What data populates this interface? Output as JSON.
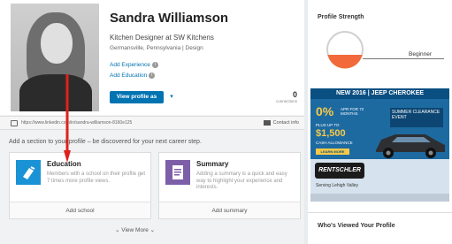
{
  "profile": {
    "name": "Sandra Williamson",
    "headline": "Kitchen Designer at SW Kitchens",
    "location": "Germansville, Pennsylvania | Design",
    "add_experience": "Add Experience",
    "add_education": "Add Education",
    "view_profile_as": "View profile as",
    "connections_count": "0",
    "connections_label": "connections",
    "url": "https://www.linkedin.com/in/sandra-williamson-8160e125",
    "contact_info": "Contact info"
  },
  "add_section": {
    "hint": "Add a section to your profile – be discovered for your next career step.",
    "cards": [
      {
        "title": "Education",
        "desc": "Members with a school on their profile get 7 times more profile views.",
        "action": "Add school",
        "icon": "graduation-icon",
        "color": "#1a92d6"
      },
      {
        "title": "Summary",
        "desc": "Adding a summary is a quick and easy way to highlight your experience and interests.",
        "action": "Add summary",
        "icon": "document-icon",
        "color": "#7d5fa8"
      }
    ],
    "view_more": "View More"
  },
  "sidebar": {
    "profile_strength_title": "Profile Strength",
    "strength_level": "Beginner",
    "strength_fraction": 0.25,
    "whos_viewed_title": "Who's Viewed Your Profile"
  },
  "ad": {
    "headline": "NEW 2016 | JEEP CHEROKEE",
    "apr": "0%",
    "apr_text": "APR FOR 72 MONTHS",
    "plus_up_to": "PLUS UP TO",
    "cash": "$1,500",
    "cash_text": "CASH ALLOWANCE",
    "learn_more": "LEARN MORE",
    "event": "SUMMER CLEARANCE EVENT",
    "dealer": "RENTSCHLER",
    "serving": "Serving Lehigh Valley"
  },
  "colors": {
    "accent": "#0073b1",
    "arrow": "#e0201b",
    "gauge_fill": "#f26a3b"
  }
}
